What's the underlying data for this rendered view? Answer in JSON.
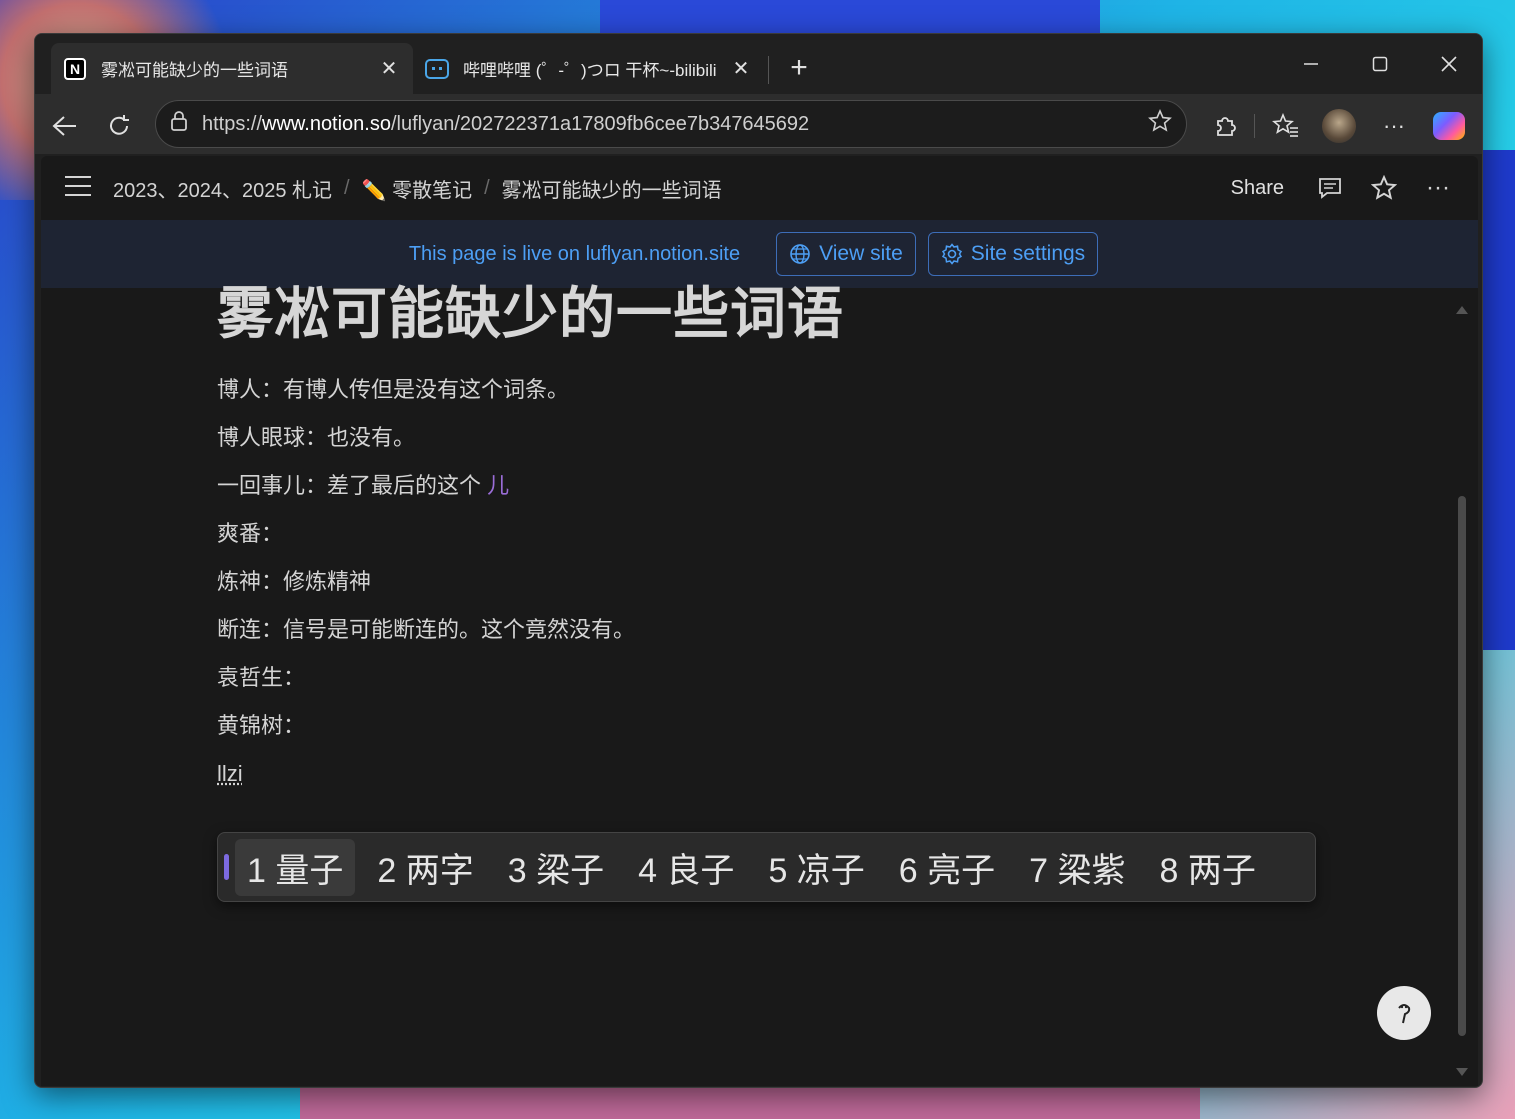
{
  "tabs": [
    {
      "title": "雾凇可能缺少的一些词语",
      "icon": "notion-icon",
      "active": true
    },
    {
      "title": "哔哩哔哩 (゜-゜)つロ 干杯~-bilibili",
      "icon": "bilibili-icon",
      "active": false
    }
  ],
  "address": {
    "scheme": "https://",
    "host": "www.notion.so",
    "path": "/luflyan/202722371a17809fb6cee7b347645692"
  },
  "breadcrumbs": {
    "item1": "2023、2024、2025 札记",
    "item2_icon": "✏️",
    "item2": "零散笔记",
    "item3": "雾凇可能缺少的一些词语"
  },
  "topbar": {
    "share": "Share"
  },
  "banner": {
    "text": "This page is live on luflyan.notion.site",
    "view_site": "View site",
    "site_settings": "Site settings"
  },
  "page": {
    "title": "雾凇可能缺少的一些词语",
    "lines": [
      "博人：有博人传但是没有这个词条。",
      "博人眼球：也没有。",
      "一回事儿：差了最后的这个 ",
      "爽番：",
      "炼神：修炼精神",
      "断连：信号是可能断连的。这个竟然没有。",
      "袁哲生：",
      "黄锦树："
    ],
    "highlight": "儿",
    "typing": "llzi"
  },
  "ime": {
    "candidates": [
      "1 量子",
      "2 两字",
      "3 梁子",
      "4 良子",
      "5 凉子",
      "6 亮子",
      "7 梁紫",
      "8 两子"
    ]
  },
  "colors": {
    "accent_blue": "#4d9ff5",
    "purple_text": "#9a6dd7",
    "ime_cursor": "#7c6ae0"
  }
}
